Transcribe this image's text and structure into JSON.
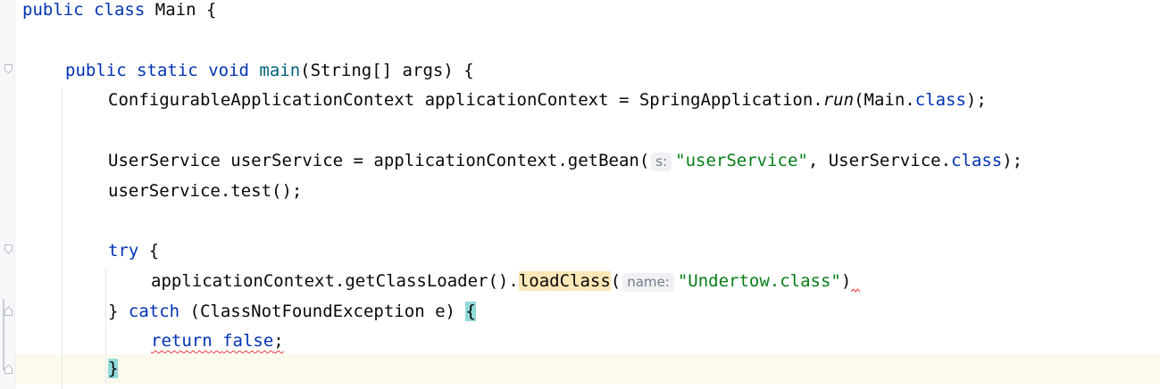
{
  "code": {
    "l1": {
      "kw1": "public",
      "kw2": "class",
      "name": "Main",
      "brace": "{"
    },
    "l3": {
      "kw1": "public",
      "kw2": "static",
      "kw3": "void",
      "fn": "main",
      "params": "(String[] args) {"
    },
    "l4": {
      "pre": "ConfigurableApplicationContext applicationContext = SpringApplication.",
      "run": "run",
      "mid": "(Main.",
      "kw": "class",
      "end": ");"
    },
    "l6": {
      "pre": "UserService userService = applicationContext.getBean(",
      "hint": "s:",
      "str": "\"userService\"",
      "mid": ", UserService.",
      "kw": "class",
      "end": ");"
    },
    "l7": {
      "text": "userService.test();"
    },
    "l9": {
      "kw": "try",
      "rest": " {"
    },
    "l10": {
      "pre": "applicationContext.getClassLoader().",
      "hl": "loadClass",
      "paren": "(",
      "hint": "name:",
      "str": "\"Undertow.class\"",
      "end": ")"
    },
    "l11": {
      "pre": "} ",
      "kw": "catch",
      "mid": " (ClassNotFoundException e) ",
      "brace": "{"
    },
    "l12": {
      "kw1": "return",
      "sp": " ",
      "kw2": "false",
      "end": ";"
    },
    "l13": {
      "brace": "}"
    }
  },
  "colors": {
    "keyword": "#0033b3",
    "method": "#00627a",
    "string": "#067d17",
    "hint_bg": "#f0f1f4",
    "usage_highlight": "#fbe7b7",
    "brace_match": "#93d9d9",
    "caret_row": "#fcfaed",
    "error_underline": "#e23b3b"
  },
  "icons": [
    "fold-marker-icon",
    "fold-end-icon"
  ]
}
